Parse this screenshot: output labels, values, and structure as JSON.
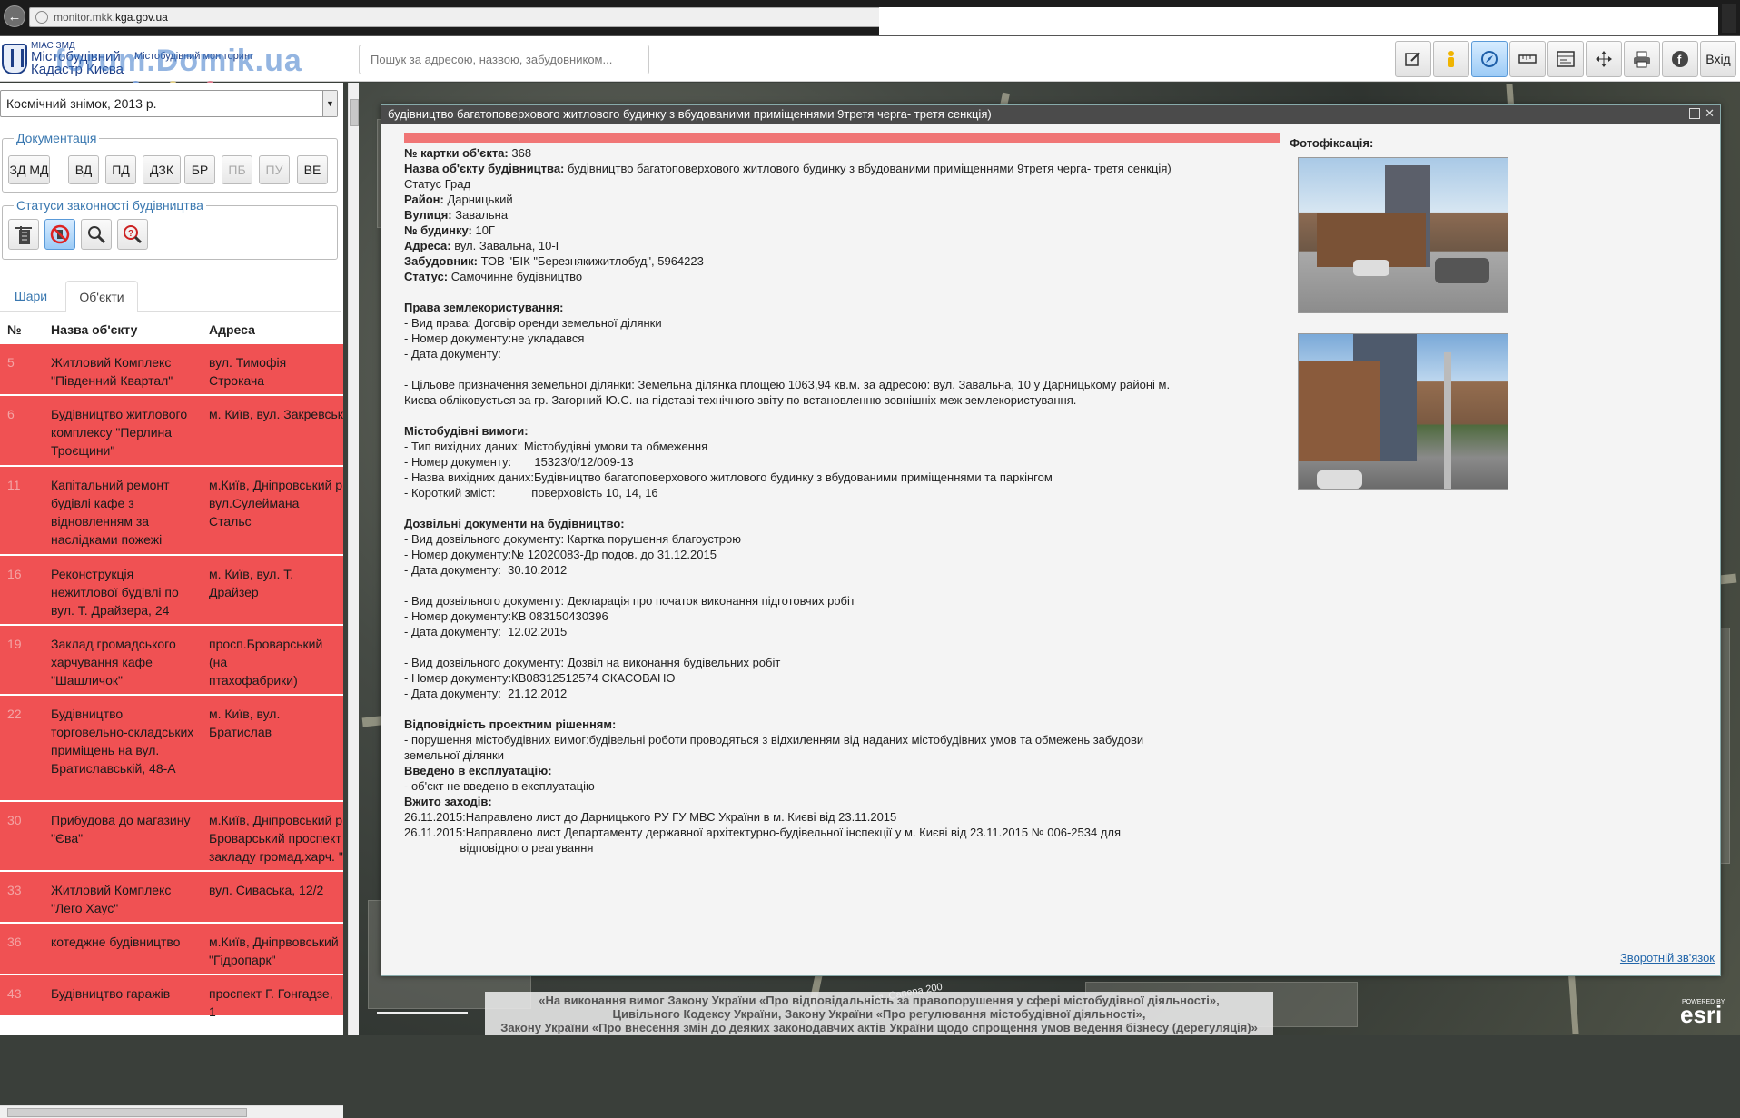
{
  "browser": {
    "url_prefix": "monitor.mkk.",
    "url_domain": "kga.gov.ua"
  },
  "header": {
    "app_small": "МІАС ЗМД",
    "logo_line1": "Містобудівний",
    "logo_line2": "Кадастр Києва",
    "logo_sub": "Містобудівний моніторинг",
    "watermark": "forum.Domik.ua",
    "search_placeholder": "Пошук за адресою, назвою, забудовником...",
    "exit_label": "Вхід"
  },
  "toolbar": {
    "icons": [
      "edit-icon",
      "street-view-icon",
      "compass-icon",
      "measure-icon",
      "layers-panel-icon",
      "move-icon",
      "print-icon",
      "facebook-icon"
    ],
    "active": "compass-icon"
  },
  "left_panel": {
    "basemap": "Космічний знімок, 2013 р.",
    "docs_title": "Документація",
    "doc_buttons": [
      "ЗД МД",
      "ВД",
      "ПД",
      "ДЗК",
      "БР",
      "ПБ",
      "ПУ",
      "ВЕ"
    ],
    "doc_disabled": [
      "ПБ",
      "ПУ"
    ],
    "status_title": "Статуси законності будівництва",
    "tabs": {
      "layers": "Шари",
      "objects": "Об'єкти"
    },
    "columns": {
      "num": "№",
      "name": "Назва об'єкту",
      "addr": "Адреса"
    },
    "rows": [
      {
        "num": "5",
        "name": "Житловий Комплекс \"Південний Квартал\"",
        "addr": "вул. Тимофія Строкача"
      },
      {
        "num": "6",
        "name": "Будівництво житлового комплексу \"Перлина Троєщини\"",
        "addr": "м. Київ, вул. Закревськ"
      },
      {
        "num": "11",
        "name": "Капітальний ремонт будівлі кафе з відновленням за наслідками пожежі",
        "addr": "м.Київ, Дніпровський р\nвул.Сулеймана Стальс"
      },
      {
        "num": "16",
        "name": "Реконструкція нежитлової будівлі по вул. Т. Драйзера, 24",
        "addr": "м. Київ, вул. Т. Драйзер"
      },
      {
        "num": "19",
        "name": "Заклад громадського харчування кафе \"Шашличок\"",
        "addr": "просп.Броварський (на\nптахофабрики)"
      },
      {
        "num": "22",
        "name": "Будівництво торговельно-складських приміщень на вул. Братиславській, 48-А",
        "addr": "м. Київ, вул. Братислав"
      },
      {
        "num": "30",
        "name": "Прибудова до магазину \"Єва\"",
        "addr": "м.Київ, Дніпровський р\nБроварський проспект\nзакладу громад.харч. \""
      },
      {
        "num": "33",
        "name": "Житловий Комплекс \"Лего Хаус\"",
        "addr": "вул. Сиваська, 12/2"
      },
      {
        "num": "36",
        "name": "котеджне будівництво",
        "addr": "м.Київ, Дніпрвовський\n\"Гідропарк\""
      },
      {
        "num": "43",
        "name": "Будівництво гаражів",
        "addr": "проспект Г. Гонгадзе, 1"
      }
    ]
  },
  "popup": {
    "title": "будівництво багатоповерхового житлового будинку з вбудованими приміщеннями 9третя черга- третя сенкція)",
    "status_color": "#f07575",
    "photos_label": "Фотофіксація:",
    "feedback": "Зворотній зв'язок",
    "lines": [
      {
        "b": "№ картки об'єкта:",
        "t": " 368"
      },
      {
        "b": "Назва об'єкту будівництва:",
        "t": " будівництво багатоповерхового житлового будинку з вбудованими приміщеннями 9третя черга- третя сенкція)"
      },
      {
        "b": "",
        "t": "Статус Град"
      },
      {
        "b": "Район:",
        "t": " Дарницький"
      },
      {
        "b": "Вулиця:",
        "t": " Завальна"
      },
      {
        "b": "№ будинку:",
        "t": " 10Г"
      },
      {
        "b": "Адреса:",
        "t": " вул. Завальна, 10-Г"
      },
      {
        "b": "Забудовник:",
        "t": " ТОВ \"БІК \"Березнякижитлобуд\", 5964223"
      },
      {
        "b": "Статус:",
        "t": " Самочинне будівництво"
      },
      {
        "gap": true
      },
      {
        "b": "Права землекористування:",
        "t": ""
      },
      {
        "b": "",
        "t": "- Вид права: Договір оренди земельної ділянки"
      },
      {
        "b": "",
        "t": "- Номер документу:не укладався"
      },
      {
        "b": "",
        "t": "- Дата документу:"
      },
      {
        "gap": true
      },
      {
        "b": "",
        "t": "- Цільове призначення земельної ділянки: Земельна ділянка площею 1063,94 кв.м. за адресою: вул. Завальна, 10 у Дарницькому районі м."
      },
      {
        "b": "",
        "t": "Києва обліковується за гр. Загорний Ю.С. на підставі технічного звіту по встановленню зовнішніх меж землекористування."
      },
      {
        "gap": true
      },
      {
        "b": "Містобудівні вимоги:",
        "t": ""
      },
      {
        "b": "",
        "t": "- Тип вихідних даних: Містобудівні умови та обмеження"
      },
      {
        "b": "",
        "t": "- Номер документу:       15323/0/12/009-13"
      },
      {
        "b": "",
        "t": "- Назва вихідних даних:Будівництво багатоповерхового житлового будинку з вбудованими приміщеннями та паркінгом"
      },
      {
        "b": "",
        "t": "- Короткий зміст:           поверховість 10, 14, 16"
      },
      {
        "gap": true
      },
      {
        "b": "Дозвільні документи на будівництво:",
        "t": ""
      },
      {
        "b": "",
        "t": "- Вид дозвільного документу: Картка порушення благоустрою"
      },
      {
        "b": "",
        "t": "- Номер документу:№ 12020083-Др подов. до 31.12.2015"
      },
      {
        "b": "",
        "t": "- Дата документу:  30.10.2012"
      },
      {
        "gap": true
      },
      {
        "b": "",
        "t": "- Вид дозвільного документу: Декларація про початок виконання підготовчих робіт"
      },
      {
        "b": "",
        "t": "- Номер документу:КВ 083150430396"
      },
      {
        "b": "",
        "t": "- Дата документу:  12.02.2015"
      },
      {
        "gap": true
      },
      {
        "b": "",
        "t": "- Вид дозвільного документу: Дозвіл на виконання будівельних робіт"
      },
      {
        "b": "",
        "t": "- Номер документу:КВ08312512574 СКАСОВАНО"
      },
      {
        "b": "",
        "t": "- Дата документу:  21.12.2012"
      },
      {
        "gap": true
      },
      {
        "b": "Відповідність проектним рішенням:",
        "t": ""
      },
      {
        "b": "",
        "t": "- порушення містобудівних вимог:будівельні роботи проводяться з відхиленням від наданих містобудівних умов та обмежень забудови"
      },
      {
        "b": "",
        "t": "земельної ділянки"
      },
      {
        "b": "Введено в експлуатацію:",
        "t": ""
      },
      {
        "b": "",
        "t": "- об'єкт не введено в експлуатацію"
      },
      {
        "b": "Вжито заходів:",
        "t": ""
      },
      {
        "b": "",
        "t": "26.11.2015:Направлено лист до Дарницького РУ ГУ МВС України в м. Києві від 23.11.2015"
      },
      {
        "b": "",
        "t": "26.11.2015:Направлено лист Департаменту державної архітектурно-будівельної інспекції у м. Києві від 23.11.2015 № 006-2534 для"
      },
      {
        "b": "",
        "t": "                 відповідного реагування"
      }
    ]
  },
  "map": {
    "street_label": "вул. Сапера 200",
    "legal_notice": "«На виконання вимог Закону України «Про відповідальність за правопорушення у сфері містобудівної діяльності»,\nЦивільного Кодексу України, Закону України «Про регулювання містобудівної діяльності»,\nЗакону України «Про внесення змін до деяких законодавчих актів України щодо спрощення умов ведення бізнесу (дерегуляція)»",
    "esri_small": "POWERED BY",
    "esri": "esri"
  }
}
